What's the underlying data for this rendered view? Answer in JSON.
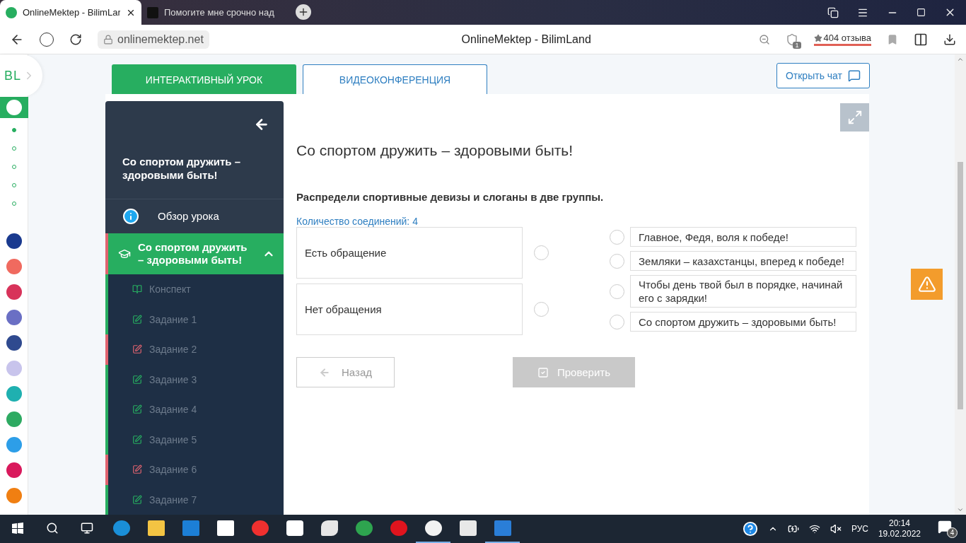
{
  "browser": {
    "tabs": [
      {
        "title": "OnlineMektep - BilimLar",
        "selected": true
      },
      {
        "title": "Помогите мне срочно над",
        "selected": false
      }
    ],
    "url": "onlinemektep.net",
    "page_title": "OnlineMektep - BilimLand",
    "shield_count": "1",
    "reviews": "404 отзыва"
  },
  "rail": {
    "logo": "BL",
    "dots": [
      {
        "selected": true
      },
      {
        "selected": false
      },
      {
        "selected": false
      },
      {
        "selected": false
      },
      {
        "selected": false
      }
    ],
    "apps": [
      {
        "color": "#1a3a8f"
      },
      {
        "color": "#f06a5f"
      },
      {
        "color": "#d8335a"
      },
      {
        "color": "#6a6fc4"
      },
      {
        "color": "#2f4a8f"
      },
      {
        "color": "#c8c4ec"
      },
      {
        "color": "#1fb0b0"
      },
      {
        "color": "#2eaa62"
      },
      {
        "color": "#2d9ee8"
      },
      {
        "color": "#d9195c"
      },
      {
        "color": "#f07f12"
      }
    ]
  },
  "top_tabs": [
    {
      "label": "ИНТЕРАКТИВНЫЙ УРОК",
      "selected": true
    },
    {
      "label": "ВИДЕОКОНФЕРЕНЦИЯ",
      "selected": false
    }
  ],
  "chat_button": "Открыть чат",
  "sidebar": {
    "title": "Со спортом дружить – здоровыми быть!",
    "overview": "Обзор урока",
    "section": {
      "title": "Со спортом дружить – здоровыми быть!",
      "expanded": true
    },
    "items": [
      {
        "kind": "notes",
        "label": "Конспект",
        "color": "#27ae60"
      },
      {
        "kind": "task",
        "label": "Задание 1",
        "color": "#27ae60"
      },
      {
        "kind": "task",
        "label": "Задание 2",
        "color": "#e0636f"
      },
      {
        "kind": "task",
        "label": "Задание 3",
        "color": "#27ae60"
      },
      {
        "kind": "task",
        "label": "Задание 4",
        "color": "#27ae60"
      },
      {
        "kind": "task",
        "label": "Задание 5",
        "color": "#27ae60"
      },
      {
        "kind": "task",
        "label": "Задание 6",
        "color": "#e0636f"
      },
      {
        "kind": "task",
        "label": "Задание 7",
        "color": "#27ae60"
      }
    ]
  },
  "lesson": {
    "title": "Со спортом дружить – здоровыми быть!",
    "instruction": "Распредели спортивные девизы и слоганы в две группы.",
    "connections": "Количество соединений: 4",
    "groups": [
      "Есть обращение",
      "Нет обращения"
    ],
    "slogans": [
      "Главное, Федя, воля к победе!",
      "Земляки – казахстанцы, вперед к победе!",
      "Чтобы день твой был в порядке, начинай его с зарядки!",
      "Со спортом дружить – здоровыми быть!"
    ],
    "back_button": {
      "label": "Назад",
      "disabled": false
    },
    "check_button": {
      "label": "Проверить",
      "disabled": true
    }
  },
  "taskbar": {
    "apps": [
      {
        "kind": "edge",
        "active": false
      },
      {
        "kind": "folder",
        "active": false
      },
      {
        "kind": "mail",
        "active": false
      },
      {
        "kind": "amazon",
        "active": false
      },
      {
        "kind": "yandex",
        "active": false
      },
      {
        "kind": "dropbox",
        "active": false
      },
      {
        "kind": "bolt",
        "active": false
      },
      {
        "kind": "chrome",
        "active": false
      },
      {
        "kind": "opera",
        "active": false
      },
      {
        "kind": "ybrowser",
        "active": true
      },
      {
        "kind": "store",
        "active": false
      },
      {
        "kind": "photos",
        "active": true
      }
    ],
    "language": "РУС",
    "time": "20:14",
    "date": "19.02.2022",
    "notifications": "4"
  }
}
